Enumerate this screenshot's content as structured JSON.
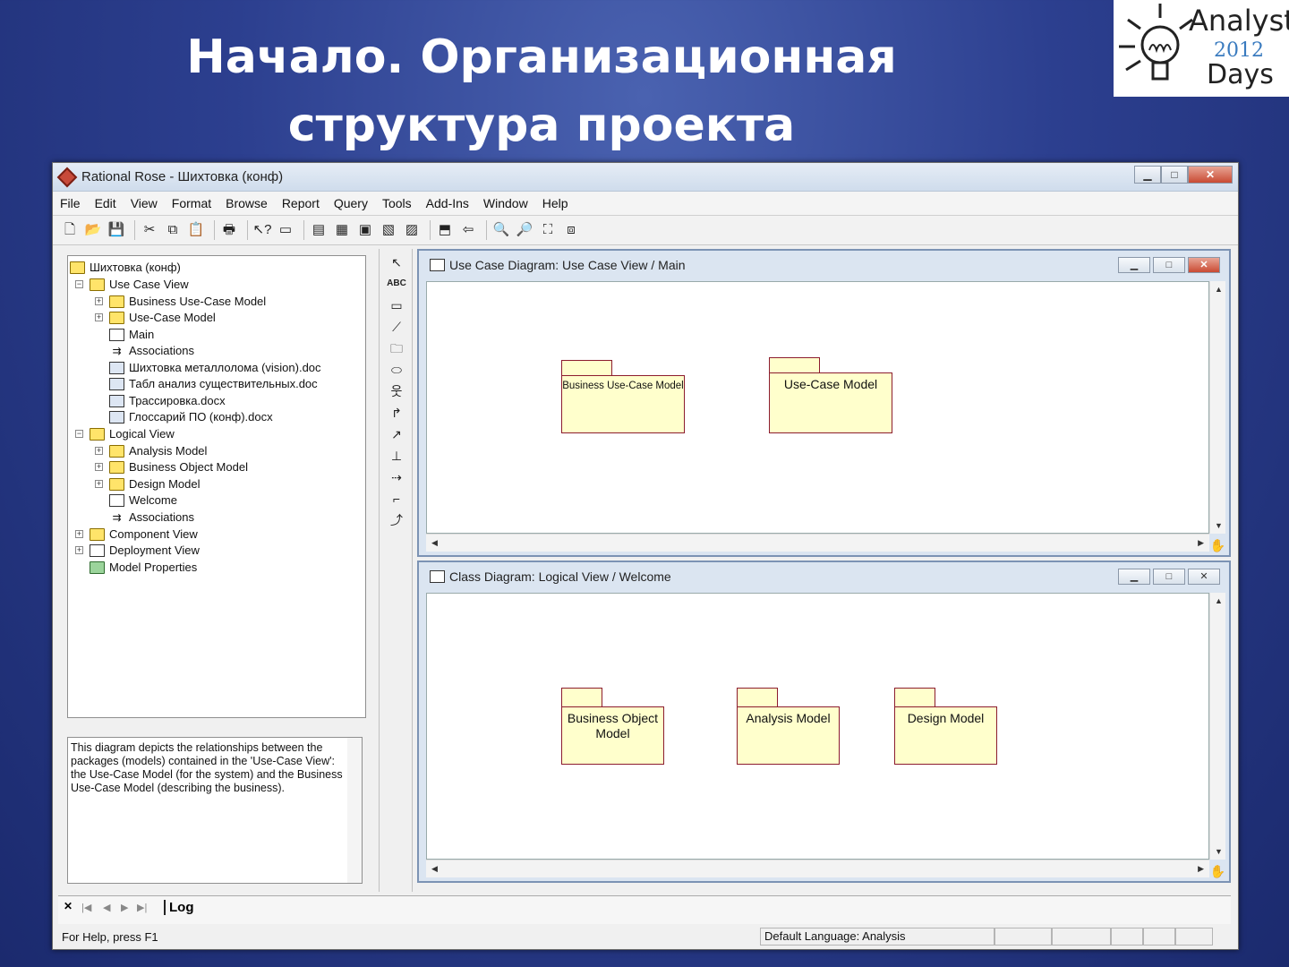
{
  "slide": {
    "title_line1": "Начало. Организационная",
    "title_line2": "структура проекта",
    "logo": {
      "analyst": "Analyst",
      "year": "2012",
      "days": "Days"
    }
  },
  "app": {
    "title": "Rational Rose - Шихтовка (конф)",
    "window_buttons": {
      "minimize": "▁",
      "maximize": "□",
      "close": "✕"
    },
    "menu": [
      "File",
      "Edit",
      "View",
      "Format",
      "Browse",
      "Report",
      "Query",
      "Tools",
      "Add-Ins",
      "Window",
      "Help"
    ]
  },
  "tree": {
    "root": "Шихтовка (конф)",
    "items": [
      {
        "label": "Use Case View",
        "icon": "folder-icon"
      },
      {
        "label": "Business Use-Case Model",
        "icon": "folder-icon"
      },
      {
        "label": "Use-Case Model",
        "icon": "folder-icon"
      },
      {
        "label": "Main",
        "icon": "diagram-icon"
      },
      {
        "label": "Associations",
        "icon": "associations-icon"
      },
      {
        "label": "Шихтовка металлолома (vision).doc",
        "icon": "document-icon"
      },
      {
        "label": "Табл анализ существительных.doc",
        "icon": "document-icon"
      },
      {
        "label": "Трассировка.docx",
        "icon": "document-icon"
      },
      {
        "label": "Глоссарий ПО (конф).docx",
        "icon": "document-icon"
      },
      {
        "label": "Logical View",
        "icon": "folder-icon"
      },
      {
        "label": "Analysis Model",
        "icon": "folder-icon"
      },
      {
        "label": "Business Object Model",
        "icon": "folder-icon"
      },
      {
        "label": "Design Model",
        "icon": "folder-icon"
      },
      {
        "label": "Welcome",
        "icon": "diagram-icon"
      },
      {
        "label": "Associations",
        "icon": "associations-icon"
      },
      {
        "label": "Component View",
        "icon": "folder-icon"
      },
      {
        "label": "Deployment View",
        "icon": "folder-icon"
      },
      {
        "label": "Model Properties",
        "icon": "properties-icon"
      }
    ]
  },
  "documentation": "This diagram depicts the relationships between the packages (models) contained in the 'Use-Case View': the Use-Case Model (for the system) and the Business Use-Case Model (describing the business).",
  "diagram1": {
    "title": "Use Case Diagram: Use Case View / Main",
    "packages": [
      "Business Use-Case Model",
      "Use-Case Model"
    ]
  },
  "diagram2": {
    "title": "Class Diagram: Logical View / Welcome",
    "packages": [
      "Business Object Model",
      "Analysis Model",
      "Design Model"
    ]
  },
  "log_tab": "Log",
  "status": {
    "help": "For Help, press F1",
    "language": "Default Language: Analysis"
  }
}
